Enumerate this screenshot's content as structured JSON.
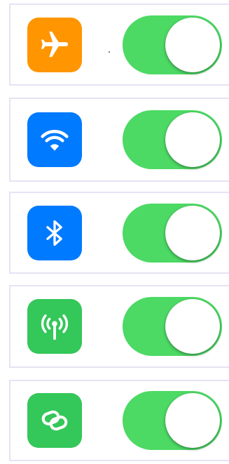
{
  "settings": [
    {
      "id": "airplane-mode",
      "icon": "airplane-icon",
      "icon_color": "#ff9500",
      "enabled": true
    },
    {
      "id": "wifi",
      "icon": "wifi-icon",
      "icon_color": "#007aff",
      "enabled": true
    },
    {
      "id": "bluetooth",
      "icon": "bluetooth-icon",
      "icon_color": "#007aff",
      "enabled": true
    },
    {
      "id": "cellular",
      "icon": "antenna-icon",
      "icon_color": "#34c759",
      "enabled": true
    },
    {
      "id": "personal-hotspot",
      "icon": "link-icon",
      "icon_color": "#34c759",
      "enabled": true
    }
  ],
  "colors": {
    "toggle_on": "#4cd964",
    "toggle_off": "#e5e5ea",
    "row_border": "#e5e3f4"
  }
}
